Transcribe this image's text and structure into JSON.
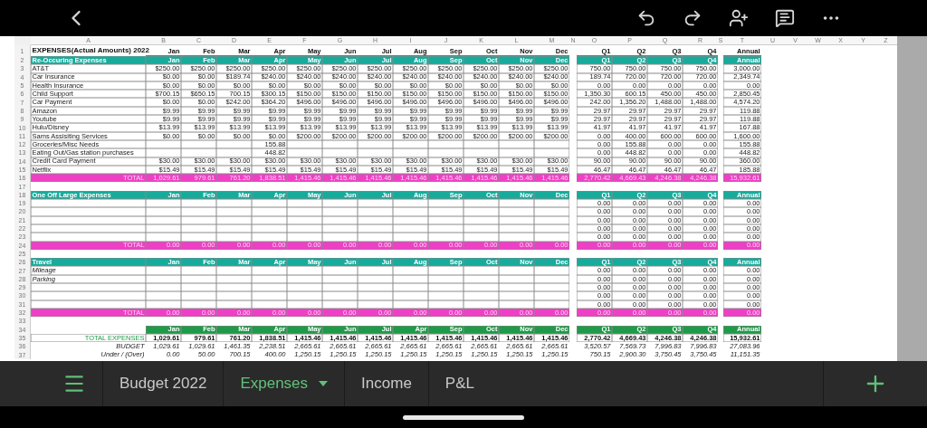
{
  "sheet": {
    "column_letters": [
      "A",
      "B",
      "C",
      "D",
      "E",
      "F",
      "G",
      "H",
      "I",
      "J",
      "K",
      "L",
      "M",
      "N",
      "O",
      "P",
      "Q",
      "R",
      "S",
      "T",
      "U",
      "V",
      "W",
      "X",
      "Y",
      "Z"
    ],
    "row_numbers": [
      "1",
      "2",
      "3",
      "4",
      "5",
      "6",
      "7",
      "8",
      "9",
      "10",
      "11",
      "12",
      "13",
      "14",
      "15",
      "16",
      "17",
      "18",
      "19",
      "20",
      "21",
      "22",
      "23",
      "24",
      "25",
      "26",
      "27",
      "28",
      "29",
      "30",
      "31",
      "32",
      "33",
      "34",
      "35",
      "36",
      "37"
    ],
    "title": "EXPENSES(Actual Amounts) 2022",
    "header": {
      "months": [
        "Jan",
        "Feb",
        "Mar",
        "Apr",
        "May",
        "Jun",
        "Jul",
        "Aug",
        "Sep",
        "Oct",
        "Nov",
        "Dec"
      ],
      "quarters": [
        "Q1",
        "Q2",
        "Q3",
        "Q4"
      ],
      "annual": "Annual"
    },
    "sections": [
      {
        "kind": "recurring",
        "title": "Re-Occuring Expenses",
        "months": [
          "Jan",
          "Feb",
          "Mar",
          "Apr",
          "May",
          "Jun",
          "Jul",
          "Aug",
          "Sep",
          "Oct",
          "Nov",
          "Dec"
        ],
        "quarters": [
          "Q1",
          "Q2",
          "Q3",
          "Q4"
        ],
        "annual_header": "Annual",
        "rows": [
          {
            "name": "AT&T",
            "months": [
              "$250.00",
              "$250.00",
              "$250.00",
              "$250.00",
              "$250.00",
              "$250.00",
              "$250.00",
              "$250.00",
              "$250.00",
              "$250.00",
              "$250.00",
              "$250.00"
            ],
            "quarters": [
              "750.00",
              "750.00",
              "750.00",
              "750.00"
            ],
            "annual": "3,000.00"
          },
          {
            "name": "Car Insurance",
            "months": [
              "$0.00",
              "$0.00",
              "$189.74",
              "$240.00",
              "$240.00",
              "$240.00",
              "$240.00",
              "$240.00",
              "$240.00",
              "$240.00",
              "$240.00",
              "$240.00"
            ],
            "quarters": [
              "189.74",
              "720.00",
              "720.00",
              "720.00"
            ],
            "annual": "2,349.74"
          },
          {
            "name": "Health Insurance",
            "months": [
              "$0.00",
              "$0.00",
              "$0.00",
              "$0.00",
              "$0.00",
              "$0.00",
              "$0.00",
              "$0.00",
              "$0.00",
              "$0.00",
              "$0.00",
              "$0.00"
            ],
            "quarters": [
              "0.00",
              "0.00",
              "0.00",
              "0.00"
            ],
            "annual": "0.00"
          },
          {
            "name": "Child Support",
            "months": [
              "$700.15",
              "$650.15",
              "700.15",
              "$300.15",
              "$150.00",
              "$150.00",
              "$150.00",
              "$150.00",
              "$150.00",
              "$150.00",
              "$150.00",
              "$150.00"
            ],
            "quarters": [
              "1,350.30",
              "600.15",
              "450.00",
              "450.00"
            ],
            "annual": "2,850.45"
          },
          {
            "name": "Car Payment",
            "months": [
              "$0.00",
              "$0.00",
              "$242.00",
              "$364.20",
              "$496.00",
              "$496.00",
              "$496.00",
              "$496.00",
              "$496.00",
              "$496.00",
              "$496.00",
              "$496.00"
            ],
            "quarters": [
              "242.00",
              "1,356.20",
              "1,488.00",
              "1,488.00"
            ],
            "annual": "4,574.20"
          },
          {
            "name": "Amazon",
            "months": [
              "$9.99",
              "$9.99",
              "$9.99",
              "$9.99",
              "$9.99",
              "$9.99",
              "$9.99",
              "$9.99",
              "$9.99",
              "$9.99",
              "$9.99",
              "$9.99"
            ],
            "quarters": [
              "29.97",
              "29.97",
              "29.97",
              "29.97"
            ],
            "annual": "119.88"
          },
          {
            "name": "Youtube",
            "months": [
              "$9.99",
              "$9.99",
              "$9.99",
              "$9.99",
              "$9.99",
              "$9.99",
              "$9.99",
              "$9.99",
              "$9.99",
              "$9.99",
              "$9.99",
              "$9.99"
            ],
            "quarters": [
              "29.97",
              "29.97",
              "29.97",
              "29.97"
            ],
            "annual": "119.88"
          },
          {
            "name": "Hulu/Disney",
            "months": [
              "$13.99",
              "$13.99",
              "$13.99",
              "$13.99",
              "$13.99",
              "$13.99",
              "$13.99",
              "$13.99",
              "$13.99",
              "$13.99",
              "$13.99",
              "$13.99"
            ],
            "quarters": [
              "41.97",
              "41.97",
              "41.97",
              "41.97"
            ],
            "annual": "167.88"
          },
          {
            "name": "Sams Assisiting Services",
            "months": [
              "$0.00",
              "$0.00",
              "$0.00",
              "$0.00",
              "$200.00",
              "$200.00",
              "$200.00",
              "$200.00",
              "$200.00",
              "$200.00",
              "$200.00",
              "$200.00"
            ],
            "quarters": [
              "0.00",
              "400.00",
              "600.00",
              "600.00"
            ],
            "annual": "1,600.00"
          },
          {
            "name": "Groceries/Misc Needs",
            "months": {
              "4": "155.88"
            },
            "quarters": [
              "0.00",
              "155.88",
              "0.00",
              "0.00"
            ],
            "annual": "155.88"
          },
          {
            "name": "Eating Out/Gas station purchases",
            "months": {
              "4": "448.82"
            },
            "quarters": [
              "0.00",
              "448.82",
              "0.00",
              "0.00"
            ],
            "annual": "448.82"
          },
          {
            "name": "Credit Card Payment",
            "months": [
              "$30.00",
              "$30.00",
              "$30.00",
              "$30.00",
              "$30.00",
              "$30.00",
              "$30.00",
              "$30.00",
              "$30.00",
              "$30.00",
              "$30.00",
              "$30.00"
            ],
            "quarters": [
              "90.00",
              "90.00",
              "90.00",
              "90.00"
            ],
            "annual": "360.00"
          },
          {
            "name": "Netflix",
            "months": [
              "$15.49",
              "$15.49",
              "$15.49",
              "$15.49",
              "$15.49",
              "$15.49",
              "$15.49",
              "$15.49",
              "$15.49",
              "$15.49",
              "$15.49",
              "$15.49"
            ],
            "quarters": [
              "46.47",
              "46.47",
              "46.47",
              "46.47"
            ],
            "annual": "185.88"
          }
        ],
        "total": {
          "label": "TOTAL",
          "months": [
            "1,029.61",
            "979.61",
            "761.20",
            "1,838.51",
            "1,415.46",
            "1,415.46",
            "1,415.46",
            "1,415.46",
            "1,415.46",
            "1,415.46",
            "1,415.46",
            "1,415.46"
          ],
          "quarters": [
            "2,770.42",
            "4,669.43",
            "4,246.38",
            "4,246.38"
          ],
          "annual": "15,932.61"
        }
      },
      {
        "kind": "one_off",
        "title": "One Off Large Expenses",
        "months": [
          "Jan",
          "Feb",
          "Mar",
          "Apr",
          "May",
          "Jun",
          "Jul",
          "Aug",
          "Sep",
          "Oct",
          "Nov",
          "Dec"
        ],
        "quarters": [
          "Q1",
          "Q2",
          "Q3",
          "Q4"
        ],
        "annual_header": "Annual",
        "rows": [
          {
            "quarters": [
              "0.00",
              "0.00",
              "0.00",
              "0.00"
            ],
            "annual": "0.00"
          },
          {
            "quarters": [
              "0.00",
              "0.00",
              "0.00",
              "0.00"
            ],
            "annual": "0.00"
          },
          {
            "quarters": [
              "0.00",
              "0.00",
              "0.00",
              "0.00"
            ],
            "annual": "0.00"
          },
          {
            "quarters": [
              "0.00",
              "0.00",
              "0.00",
              "0.00"
            ],
            "annual": "0.00"
          },
          {
            "quarters": [
              "0.00",
              "0.00",
              "0.00",
              "0.00"
            ],
            "annual": "0.00"
          }
        ],
        "total": {
          "label": "TOTAL",
          "months": [
            "0.00",
            "0.00",
            "0.00",
            "0.00",
            "0.00",
            "0.00",
            "0.00",
            "0.00",
            "0.00",
            "0.00",
            "0.00",
            "0.00"
          ],
          "quarters": [
            "0.00",
            "0.00",
            "0.00",
            "0.00"
          ],
          "annual": "0.00"
        }
      },
      {
        "kind": "travel",
        "title": "Travel",
        "months": [
          "Jan",
          "Feb",
          "Mar",
          "Apr",
          "May",
          "Jun",
          "Jul",
          "Aug",
          "Sep",
          "Oct",
          "Nov",
          "Dec"
        ],
        "quarters": [
          "Q1",
          "Q2",
          "Q3",
          "Q4"
        ],
        "annual_header": "Annual",
        "rows": [
          {
            "name": "Mileage",
            "quarters": [
              "0.00",
              "0.00",
              "0.00",
              "0.00"
            ],
            "annual": "0.00"
          },
          {
            "name": "Parking",
            "quarters": [
              "0.00",
              "0.00",
              "0.00",
              "0.00"
            ],
            "annual": "0.00"
          },
          {
            "quarters": [
              "0.00",
              "0.00",
              "0.00",
              "0.00"
            ],
            "annual": "0.00"
          },
          {
            "quarters": [
              "0.00",
              "0.00",
              "0.00",
              "0.00"
            ],
            "annual": "0.00"
          },
          {
            "quarters": [
              "0.00",
              "0.00",
              "0.00",
              "0.00"
            ],
            "annual": "0.00"
          }
        ],
        "total": {
          "label": "TOTAL",
          "months": [
            "0.00",
            "0.00",
            "0.00",
            "0.00",
            "0.00",
            "0.00",
            "0.00",
            "0.00",
            "0.00",
            "0.00",
            "0.00",
            "0.00"
          ],
          "quarters": [
            "0.00",
            "0.00",
            "0.00",
            "0.00"
          ],
          "annual": "0.00"
        }
      }
    ],
    "summary": {
      "months": [
        "Jan",
        "Feb",
        "Mar",
        "Apr",
        "May",
        "Jun",
        "Jul",
        "Apr",
        "Sep",
        "Oct",
        "Nov",
        "Dec"
      ],
      "quarters": [
        "Q1",
        "Q2",
        "Q3",
        "Q4"
      ],
      "annual_header": "Annual",
      "rows": [
        {
          "kind": "total",
          "label": "TOTAL EXPENSES",
          "months": [
            "1,029.61",
            "979.61",
            "761.20",
            "1,838.51",
            "1,415.46",
            "1,415.46",
            "1,415.46",
            "1,415.46",
            "1,415.46",
            "1,415.46",
            "1,415.46",
            "1,415.46"
          ],
          "quarters": [
            "2,770.42",
            "4,669.43",
            "4,246.38",
            "4,246.38"
          ],
          "annual": "15,932.61"
        },
        {
          "kind": "budget",
          "label": "BUDGET",
          "months": [
            "1,029.61",
            "1,029.61",
            "1,461.35",
            "2,238.51",
            "2,665.61",
            "2,665.61",
            "2,665.61",
            "2,665.61",
            "2,665.61",
            "2,665.61",
            "2,665.61",
            "2,665.61"
          ],
          "quarters": [
            "3,520.57",
            "7,569.73",
            "7,996.83",
            "7,996.83"
          ],
          "annual": "27,083.96"
        },
        {
          "kind": "variance",
          "label": "Under / (Over)",
          "months": [
            "0.00",
            "50.00",
            "700.15",
            "400.00",
            "1,250.15",
            "1,250.15",
            "1,250.15",
            "1,250.15",
            "1,250.15",
            "1,250.15",
            "1,250.15",
            "1,250.15"
          ],
          "quarters": [
            "750.15",
            "2,900.30",
            "3,750.45",
            "3,750.45"
          ],
          "annual": "11,151.35"
        }
      ]
    }
  },
  "tabs": [
    {
      "label": "Budget 2022",
      "selected": false
    },
    {
      "label": "Expenses",
      "selected": true
    },
    {
      "label": "Income",
      "selected": false
    },
    {
      "label": "P&L",
      "selected": false
    }
  ]
}
